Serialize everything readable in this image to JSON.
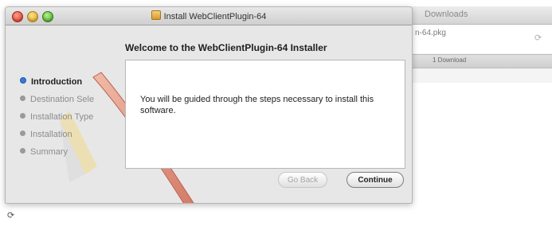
{
  "downloads_window": {
    "title": "Downloads",
    "item": {
      "filename": "n-64.pkg"
    },
    "status": "1 Download"
  },
  "installer": {
    "window_title": "Install WebClientPlugin-64",
    "heading": "Welcome to the WebClientPlugin-64 Installer",
    "steps": [
      {
        "label": "Introduction",
        "active": true
      },
      {
        "label": "Destination Sele",
        "active": false
      },
      {
        "label": "Installation Type",
        "active": false
      },
      {
        "label": "Installation",
        "active": false
      },
      {
        "label": "Summary",
        "active": false
      }
    ],
    "body_text": "You will be guided through the steps necessary to install this software.",
    "buttons": {
      "back": "Go Back",
      "continue": "Continue"
    }
  },
  "icons": {
    "package": "package-icon",
    "refresh": "refresh-icon",
    "stray": "refresh-icon"
  },
  "colors": {
    "accent": "#3b78d8",
    "close_light": "#d5321e",
    "min_light": "#d9a21a",
    "max_light": "#3f9f23"
  }
}
